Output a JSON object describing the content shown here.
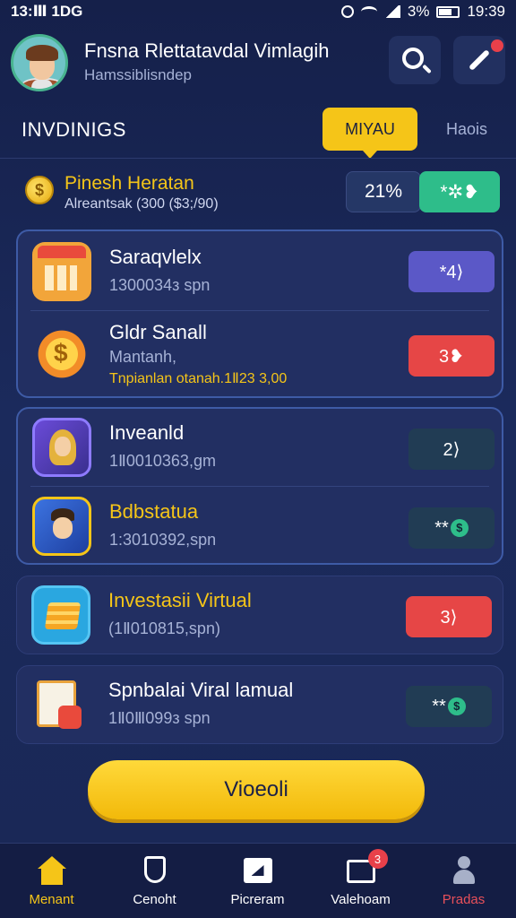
{
  "status_bar": {
    "time_left": "13:Ⅲ 1DG",
    "battery_pct": "3%",
    "time_right": "19:39"
  },
  "header": {
    "user_name": "Fnsna Rlettatavdal Vimlagih",
    "user_sub": "Hamssiblisndep",
    "search_icon": "search-icon",
    "tool_icon": "tool-icon"
  },
  "section": {
    "title": "INVDINIGS",
    "tab_active": "MIYAU",
    "tab_inactive": "Haois"
  },
  "summary": {
    "title": "Pinesh Heratan",
    "subtitle": "Alreantsak (300 ($3;/90)",
    "percent": "21%",
    "action": "*✲❥",
    "accent": "#2ebd8a"
  },
  "group1": [
    {
      "title": "Saraqvlelx",
      "sub": "1300034з spn",
      "action": "*4⟩",
      "action_color": "#5b58c7"
    },
    {
      "title": "Gldr Sanall",
      "sub": "Mantanh,",
      "sub2": "Tnpianlan otanah.1Ⅱ23 3,00",
      "action": "3❥",
      "action_color": "#e64646"
    }
  ],
  "group2": [
    {
      "title": "Inveanld",
      "sub": "1Ⅱ0010363,gm",
      "action": "2⟩"
    },
    {
      "title": "Bdbstatua",
      "sub": "1:3010392,spn",
      "action": "**"
    }
  ],
  "items": [
    {
      "title": "Investasii Virtual",
      "sub": "(1Ⅱ010815,spn)",
      "action": "3⟩",
      "action_color": "#e64646"
    },
    {
      "title": "Spnbalai Viral lamual",
      "sub": "1Ⅱ0Ⅲ099з spn",
      "action": "**"
    }
  ],
  "primary_button": "Vioeoli",
  "bottom_nav": [
    {
      "label": "Menant",
      "icon": "home-icon"
    },
    {
      "label": "Cenoht",
      "icon": "shield-icon"
    },
    {
      "label": "Picreram",
      "icon": "card-icon"
    },
    {
      "label": "Valehoam",
      "icon": "wallet-icon",
      "badge": "3"
    },
    {
      "label": "Pradas",
      "icon": "profile-icon"
    }
  ]
}
